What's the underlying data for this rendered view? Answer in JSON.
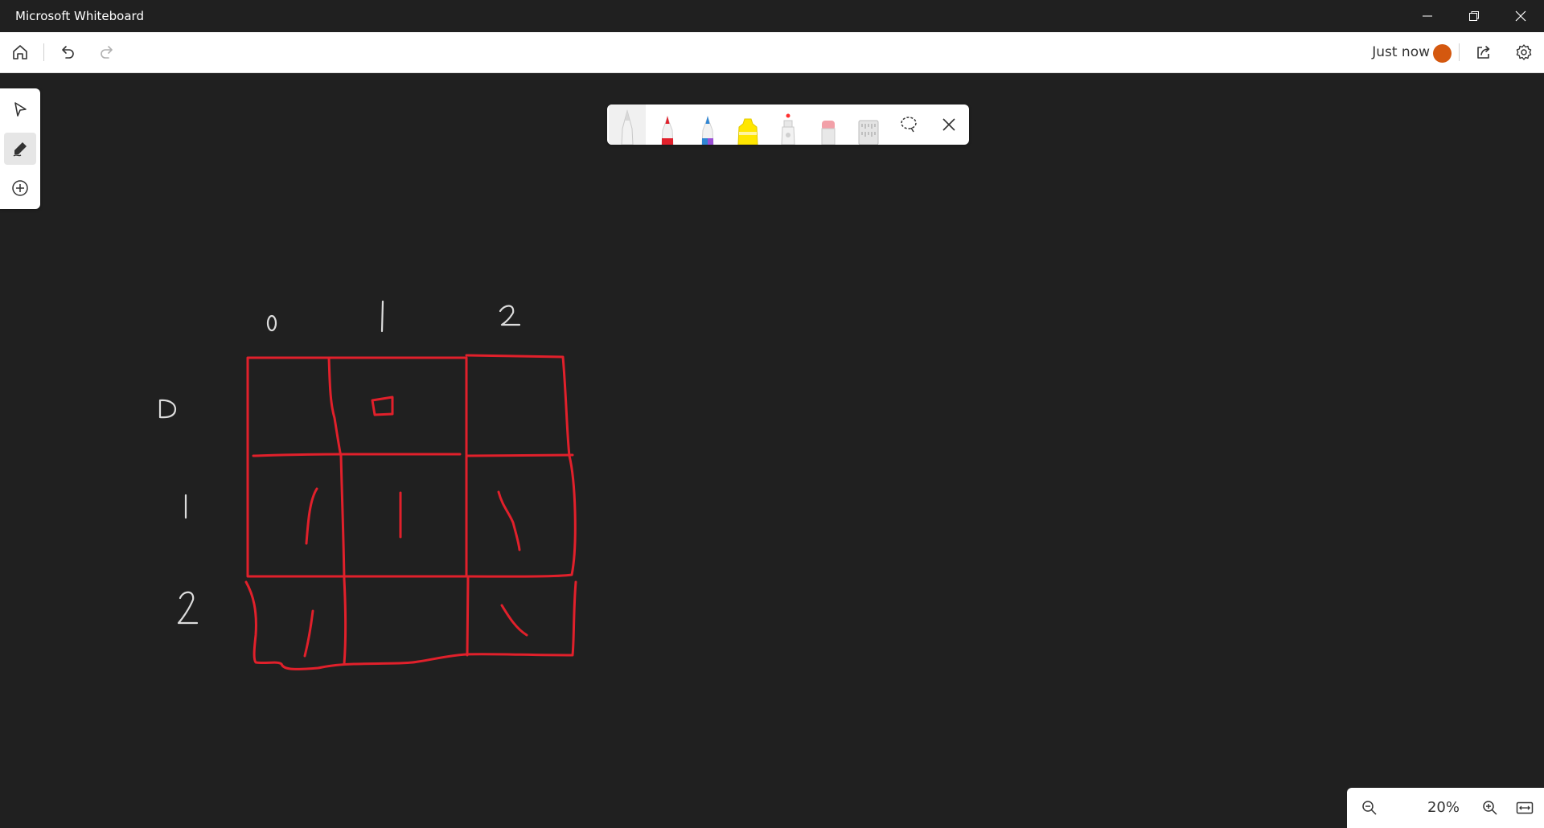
{
  "window": {
    "title": "Microsoft Whiteboard",
    "controls": [
      "minimize-icon",
      "restore-icon",
      "close-icon"
    ]
  },
  "appbar": {
    "left_buttons": [
      "home-icon",
      "undo-icon",
      "redo-icon"
    ],
    "sync_status": "Just now",
    "avatar_color": "#d4580f",
    "right_buttons": [
      "share-icon",
      "settings-icon"
    ]
  },
  "side_toolbar": {
    "tools": [
      "select-icon",
      "pen-icon",
      "add-icon"
    ],
    "active": "pen-icon"
  },
  "ink_toolbar": {
    "tools": [
      {
        "icon": "white-pen-icon",
        "color": "#f2f2f2",
        "active": true
      },
      {
        "icon": "red-pen-icon",
        "color": "#e1202b"
      },
      {
        "icon": "blue-pen-icon",
        "color": "#2f86d4"
      },
      {
        "icon": "highlighter-icon",
        "color": "#ffe600"
      },
      {
        "icon": "laser-pointer-icon",
        "color": "#ff3030"
      },
      {
        "icon": "eraser-icon",
        "color": "#f2a0a8"
      },
      {
        "icon": "ruler-icon",
        "color": "#cfcfcf"
      },
      {
        "icon": "lasso-select-icon",
        "color": "#333333"
      },
      {
        "icon": "close-icon",
        "color": "#333333"
      }
    ]
  },
  "canvas": {
    "background": "#202020",
    "ink_color": "#e1202b",
    "column_labels": [
      "0",
      "1",
      "2"
    ],
    "row_labels": [
      "0",
      "1",
      "2"
    ]
  },
  "zoom": {
    "level": "20%",
    "buttons": [
      "zoom-out-icon",
      "zoom-in-icon",
      "fit-to-screen-icon"
    ]
  }
}
